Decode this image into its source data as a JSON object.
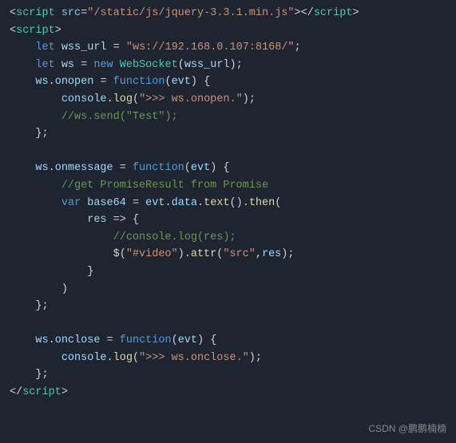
{
  "code": {
    "lines": [
      {
        "tokens": [
          {
            "cls": "c-punct",
            "text": "<"
          },
          {
            "cls": "c-tag",
            "text": "script"
          },
          {
            "cls": "c-white",
            "text": " "
          },
          {
            "cls": "c-attr",
            "text": "src"
          },
          {
            "cls": "c-punct",
            "text": "="
          },
          {
            "cls": "c-string",
            "text": "\"/static/js/jquery-3.3.1.min.js\""
          },
          {
            "cls": "c-punct",
            "text": ">"
          },
          {
            "cls": "c-punct",
            "text": "</"
          },
          {
            "cls": "c-tag",
            "text": "script"
          },
          {
            "cls": "c-punct",
            "text": ">"
          }
        ]
      },
      {
        "tokens": [
          {
            "cls": "c-punct",
            "text": "<"
          },
          {
            "cls": "c-tag",
            "text": "script"
          },
          {
            "cls": "c-punct",
            "text": ">"
          }
        ]
      },
      {
        "tokens": [
          {
            "cls": "c-white",
            "text": "    "
          },
          {
            "cls": "c-keyword",
            "text": "let"
          },
          {
            "cls": "c-white",
            "text": " "
          },
          {
            "cls": "c-var",
            "text": "wss_url"
          },
          {
            "cls": "c-white",
            "text": " "
          },
          {
            "cls": "c-punct",
            "text": "="
          },
          {
            "cls": "c-white",
            "text": " "
          },
          {
            "cls": "c-string",
            "text": "\"ws://192.168.0.107:8168/\""
          },
          {
            "cls": "c-punct",
            "text": ";"
          }
        ]
      },
      {
        "tokens": [
          {
            "cls": "c-white",
            "text": "    "
          },
          {
            "cls": "c-keyword",
            "text": "let"
          },
          {
            "cls": "c-white",
            "text": " "
          },
          {
            "cls": "c-var",
            "text": "ws"
          },
          {
            "cls": "c-white",
            "text": " "
          },
          {
            "cls": "c-punct",
            "text": "="
          },
          {
            "cls": "c-white",
            "text": " "
          },
          {
            "cls": "c-keyword",
            "text": "new"
          },
          {
            "cls": "c-white",
            "text": " "
          },
          {
            "cls": "c-cyan",
            "text": "WebSocket"
          },
          {
            "cls": "c-punct",
            "text": "("
          },
          {
            "cls": "c-var",
            "text": "wss_url"
          },
          {
            "cls": "c-punct",
            "text": ");"
          }
        ]
      },
      {
        "tokens": [
          {
            "cls": "c-white",
            "text": "    "
          },
          {
            "cls": "c-var",
            "text": "ws"
          },
          {
            "cls": "c-punct",
            "text": "."
          },
          {
            "cls": "c-var",
            "text": "onopen"
          },
          {
            "cls": "c-white",
            "text": " "
          },
          {
            "cls": "c-punct",
            "text": "="
          },
          {
            "cls": "c-white",
            "text": " "
          },
          {
            "cls": "c-keyword",
            "text": "function"
          },
          {
            "cls": "c-punct",
            "text": "("
          },
          {
            "cls": "c-var",
            "text": "evt"
          },
          {
            "cls": "c-punct",
            "text": ")"
          },
          {
            "cls": "c-white",
            "text": " "
          },
          {
            "cls": "c-punct",
            "text": "{"
          }
        ]
      },
      {
        "tokens": [
          {
            "cls": "c-white",
            "text": "        "
          },
          {
            "cls": "c-var",
            "text": "console"
          },
          {
            "cls": "c-punct",
            "text": "."
          },
          {
            "cls": "c-func",
            "text": "log"
          },
          {
            "cls": "c-punct",
            "text": "("
          },
          {
            "cls": "c-string",
            "text": "\">>> ws.onopen.\""
          },
          {
            "cls": "c-punct",
            "text": ");"
          }
        ]
      },
      {
        "tokens": [
          {
            "cls": "c-white",
            "text": "        "
          },
          {
            "cls": "c-comment",
            "text": "//ws.send(\"Test\");"
          }
        ]
      },
      {
        "tokens": [
          {
            "cls": "c-white",
            "text": "    "
          },
          {
            "cls": "c-punct",
            "text": "};"
          }
        ]
      },
      {
        "tokens": []
      },
      {
        "tokens": [
          {
            "cls": "c-white",
            "text": "    "
          },
          {
            "cls": "c-var",
            "text": "ws"
          },
          {
            "cls": "c-punct",
            "text": "."
          },
          {
            "cls": "c-var",
            "text": "onmessage"
          },
          {
            "cls": "c-white",
            "text": " "
          },
          {
            "cls": "c-punct",
            "text": "="
          },
          {
            "cls": "c-white",
            "text": " "
          },
          {
            "cls": "c-keyword",
            "text": "function"
          },
          {
            "cls": "c-punct",
            "text": "("
          },
          {
            "cls": "c-var",
            "text": "evt"
          },
          {
            "cls": "c-punct",
            "text": ")"
          },
          {
            "cls": "c-white",
            "text": " "
          },
          {
            "cls": "c-punct",
            "text": "{"
          }
        ]
      },
      {
        "tokens": [
          {
            "cls": "c-white",
            "text": "        "
          },
          {
            "cls": "c-comment",
            "text": "//get PromiseResult from Promise"
          }
        ]
      },
      {
        "tokens": [
          {
            "cls": "c-white",
            "text": "        "
          },
          {
            "cls": "c-keyword",
            "text": "var"
          },
          {
            "cls": "c-white",
            "text": " "
          },
          {
            "cls": "c-var",
            "text": "base64"
          },
          {
            "cls": "c-white",
            "text": " "
          },
          {
            "cls": "c-punct",
            "text": "="
          },
          {
            "cls": "c-white",
            "text": " "
          },
          {
            "cls": "c-var",
            "text": "evt"
          },
          {
            "cls": "c-punct",
            "text": "."
          },
          {
            "cls": "c-var",
            "text": "data"
          },
          {
            "cls": "c-punct",
            "text": "."
          },
          {
            "cls": "c-func",
            "text": "text"
          },
          {
            "cls": "c-punct",
            "text": "()."
          },
          {
            "cls": "c-func",
            "text": "then"
          },
          {
            "cls": "c-punct",
            "text": "("
          }
        ]
      },
      {
        "tokens": [
          {
            "cls": "c-white",
            "text": "            "
          },
          {
            "cls": "c-var",
            "text": "res"
          },
          {
            "cls": "c-white",
            "text": " "
          },
          {
            "cls": "c-punct",
            "text": "=>"
          },
          {
            "cls": "c-white",
            "text": " "
          },
          {
            "cls": "c-punct",
            "text": "{"
          }
        ]
      },
      {
        "tokens": [
          {
            "cls": "c-white",
            "text": "                "
          },
          {
            "cls": "c-comment",
            "text": "//console.log(res);"
          }
        ]
      },
      {
        "tokens": [
          {
            "cls": "c-white",
            "text": "                "
          },
          {
            "cls": "c-punct",
            "text": "$("
          },
          {
            "cls": "c-string",
            "text": "\"#video\""
          },
          {
            "cls": "c-punct",
            "text": ")."
          },
          {
            "cls": "c-func",
            "text": "attr"
          },
          {
            "cls": "c-punct",
            "text": "("
          },
          {
            "cls": "c-string",
            "text": "\"src\""
          },
          {
            "cls": "c-punct",
            "text": ","
          },
          {
            "cls": "c-var",
            "text": "res"
          },
          {
            "cls": "c-punct",
            "text": ");"
          }
        ]
      },
      {
        "tokens": [
          {
            "cls": "c-white",
            "text": "            "
          },
          {
            "cls": "c-punct",
            "text": "}"
          }
        ]
      },
      {
        "tokens": [
          {
            "cls": "c-white",
            "text": "        "
          },
          {
            "cls": "c-punct",
            "text": ")"
          }
        ]
      },
      {
        "tokens": [
          {
            "cls": "c-white",
            "text": "    "
          },
          {
            "cls": "c-punct",
            "text": "};"
          }
        ]
      },
      {
        "tokens": []
      },
      {
        "tokens": [
          {
            "cls": "c-white",
            "text": "    "
          },
          {
            "cls": "c-var",
            "text": "ws"
          },
          {
            "cls": "c-punct",
            "text": "."
          },
          {
            "cls": "c-var",
            "text": "onclose"
          },
          {
            "cls": "c-white",
            "text": " "
          },
          {
            "cls": "c-punct",
            "text": "="
          },
          {
            "cls": "c-white",
            "text": " "
          },
          {
            "cls": "c-keyword",
            "text": "function"
          },
          {
            "cls": "c-punct",
            "text": "("
          },
          {
            "cls": "c-var",
            "text": "evt"
          },
          {
            "cls": "c-punct",
            "text": ")"
          },
          {
            "cls": "c-white",
            "text": " "
          },
          {
            "cls": "c-punct",
            "text": "{"
          }
        ]
      },
      {
        "tokens": [
          {
            "cls": "c-white",
            "text": "        "
          },
          {
            "cls": "c-var",
            "text": "console"
          },
          {
            "cls": "c-punct",
            "text": "."
          },
          {
            "cls": "c-func",
            "text": "log"
          },
          {
            "cls": "c-punct",
            "text": "("
          },
          {
            "cls": "c-string",
            "text": "\">>> ws.onclose.\""
          },
          {
            "cls": "c-punct",
            "text": ");"
          }
        ]
      },
      {
        "tokens": [
          {
            "cls": "c-white",
            "text": "    "
          },
          {
            "cls": "c-punct",
            "text": "};"
          }
        ]
      },
      {
        "tokens": [
          {
            "cls": "c-punct",
            "text": "</"
          },
          {
            "cls": "c-tag",
            "text": "script"
          },
          {
            "cls": "c-punct",
            "text": ">"
          }
        ]
      }
    ],
    "watermark": "CSDN @鹏鹏楠楠"
  }
}
